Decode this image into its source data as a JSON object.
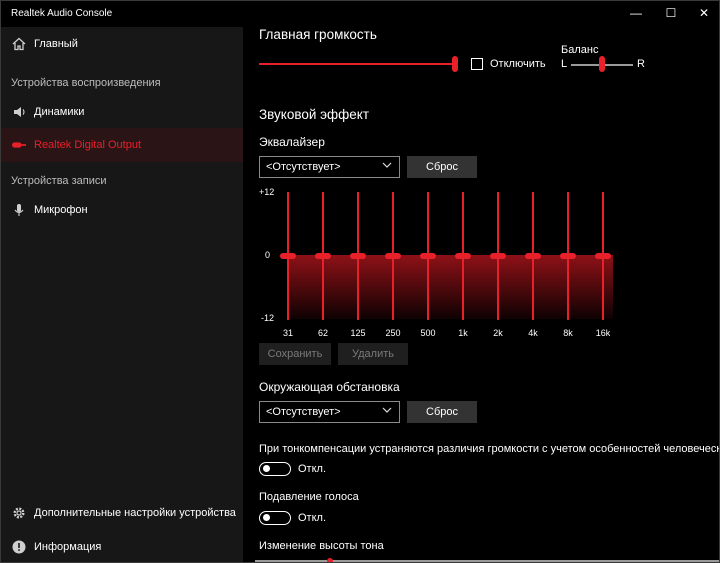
{
  "window": {
    "title": "Realtek Audio Console",
    "minimize": "—",
    "maximize": "☐",
    "close": "✕"
  },
  "sidebar": {
    "home": {
      "label": "Главный",
      "icon": "home-icon"
    },
    "playback_header": "Устройства воспроизведения",
    "speakers": {
      "label": "Динамики",
      "icon": "speaker-icon"
    },
    "digital_output": {
      "label": "Realtek Digital Output",
      "icon": "digital-output-icon"
    },
    "recording_header": "Устройства записи",
    "microphone": {
      "label": "Микрофон",
      "icon": "microphone-icon"
    },
    "advanced": {
      "label": "Дополнительные настройки устройства",
      "icon": "gear-icon"
    },
    "info": {
      "label": "Информация",
      "icon": "info-icon"
    }
  },
  "main": {
    "master_volume_title": "Главная громкость",
    "master_volume_value": 1.0,
    "mute_label": "Отключить",
    "mute_checked": false,
    "balance_label": "Баланс",
    "balance_left": "L",
    "balance_right": "R",
    "balance_value": 0.5,
    "sound_effect_title": "Звуковой эффект",
    "equalizer_title": "Эквалайзер",
    "equalizer_preset": "<Отсутствует>",
    "equalizer_reset": "Сброс",
    "eq_scale_top": "+12",
    "eq_scale_mid": "0",
    "eq_scale_bottom": "-12",
    "eq_bands": [
      {
        "freq": "31",
        "gain": 0
      },
      {
        "freq": "62",
        "gain": 0
      },
      {
        "freq": "125",
        "gain": 0
      },
      {
        "freq": "250",
        "gain": 0
      },
      {
        "freq": "500",
        "gain": 0
      },
      {
        "freq": "1k",
        "gain": 0
      },
      {
        "freq": "2k",
        "gain": 0
      },
      {
        "freq": "4k",
        "gain": 0
      },
      {
        "freq": "8k",
        "gain": 0
      },
      {
        "freq": "16k",
        "gain": 0
      }
    ],
    "save_button": "Сохранить",
    "delete_button": "Удалить",
    "environment_title": "Окружающая обстановка",
    "environment_preset": "<Отсутствует>",
    "environment_reset": "Сброс",
    "loudness_text": "При тонкомпенсации устраняются различия громкости с учетом особенностей человеческого",
    "loudness_toggle": "Откл.",
    "voice_suppression_title": "Подавление голоса",
    "voice_suppression_toggle": "Откл.",
    "pitch_title": "Изменение высоты тона"
  },
  "colors": {
    "accent": "#e8202a",
    "sidebar_bg": "#171717",
    "main_bg": "#000000"
  }
}
